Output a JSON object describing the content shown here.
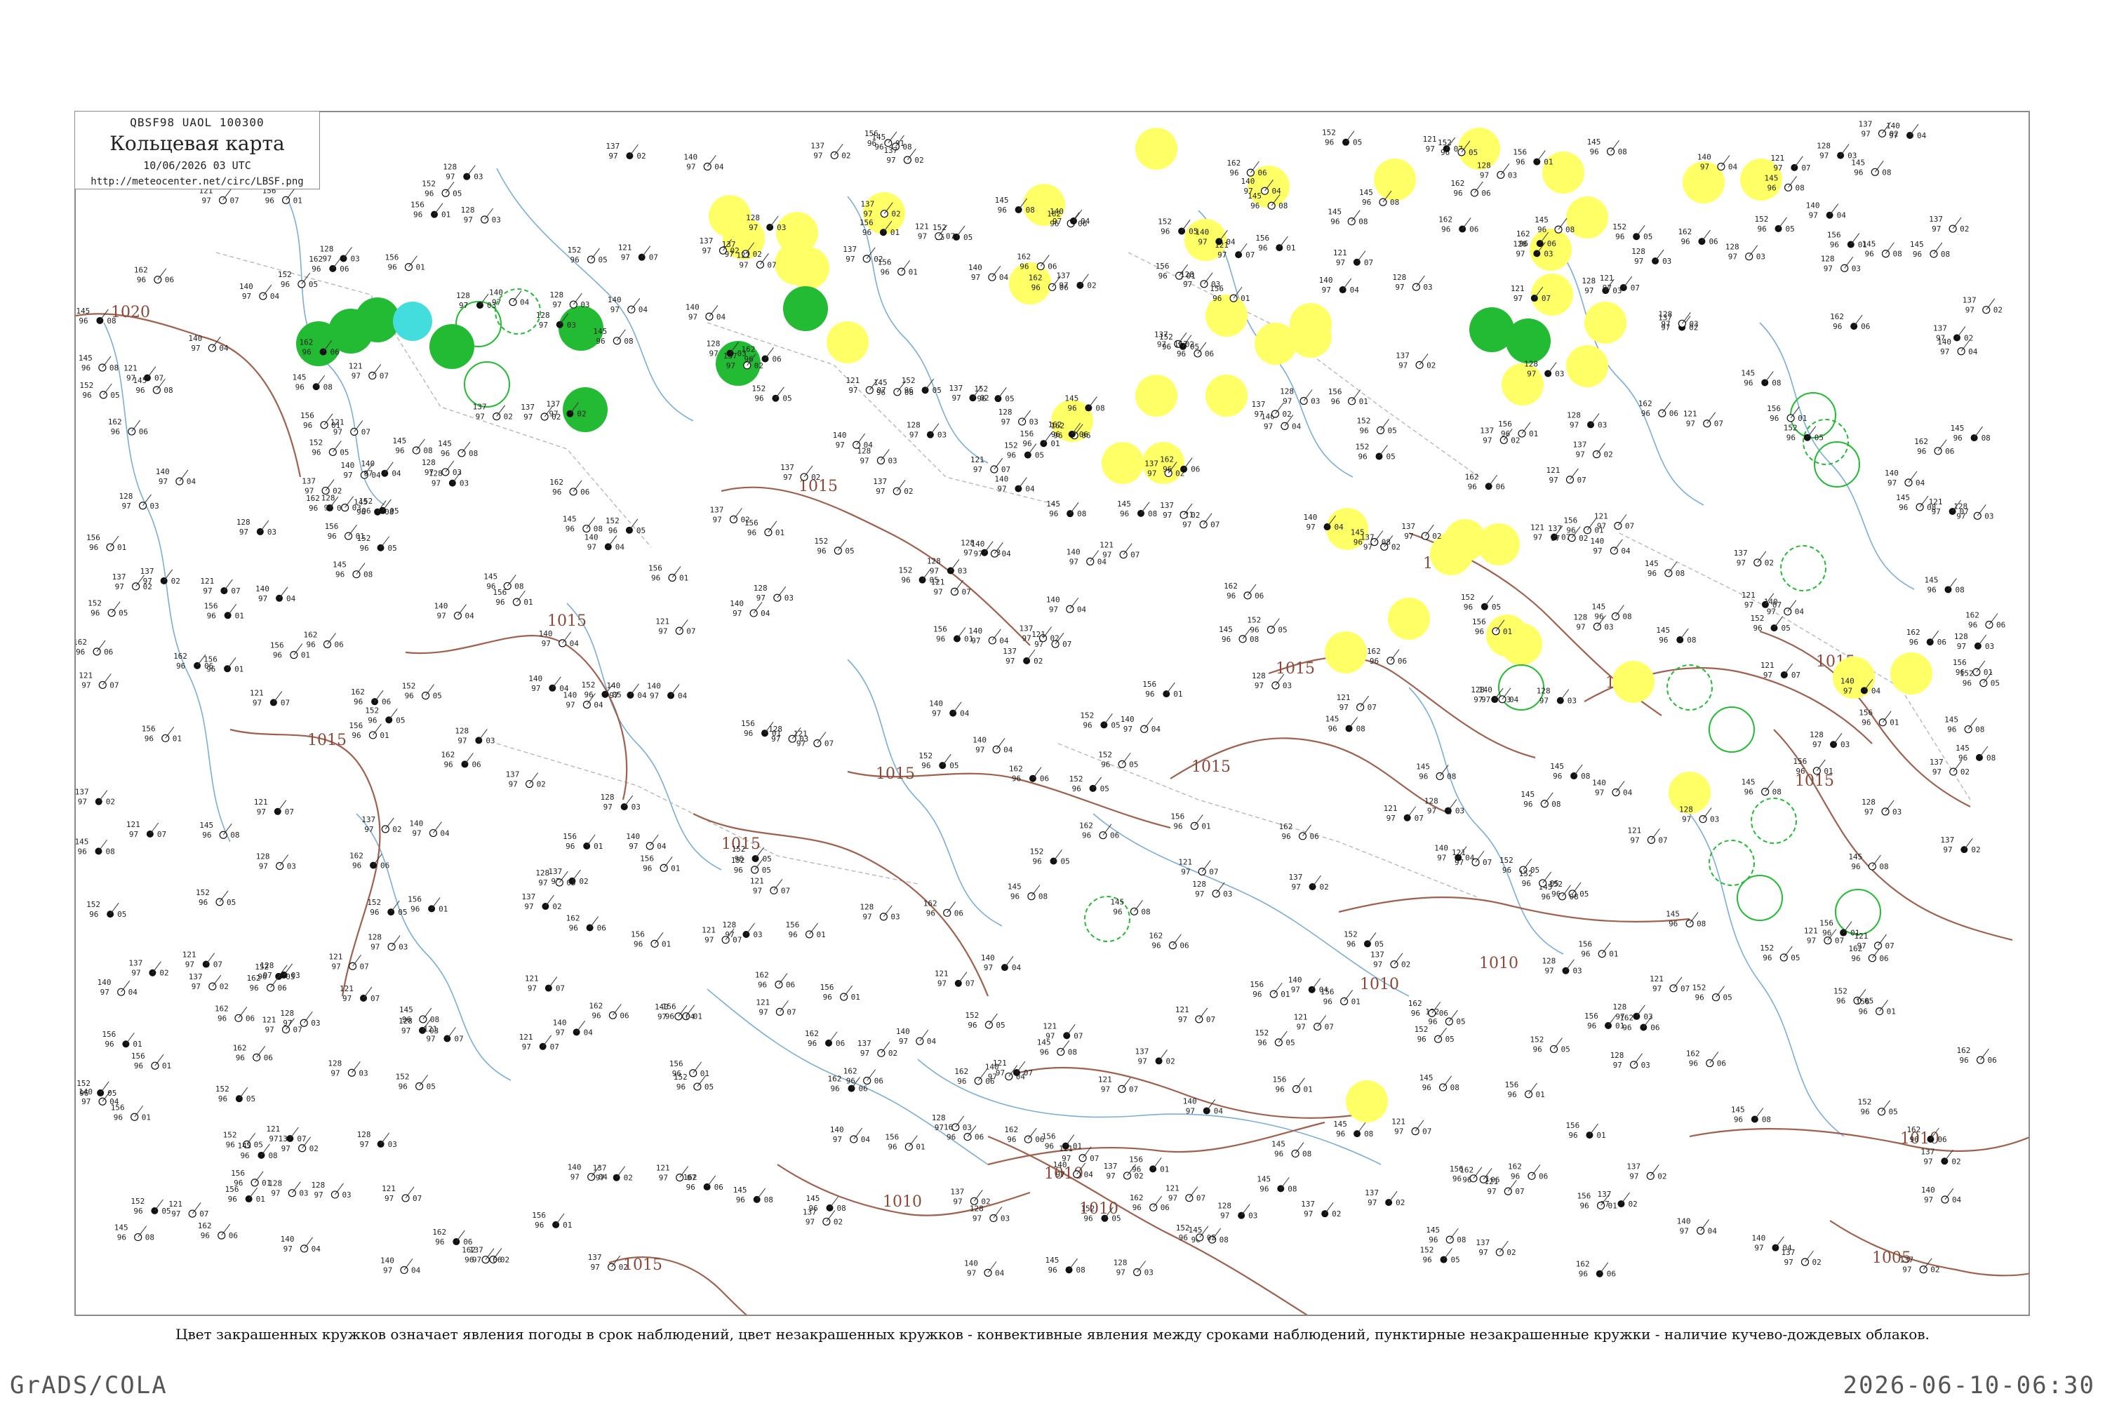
{
  "title_box": {
    "code_line": "QBSF98  UAOL  100300",
    "title": "Кольцевая карта",
    "date": "10/06/2026 03 UTC",
    "url": "http://meteocenter.net/circ/LBSF.png"
  },
  "caption": "Цвет закрашенных кружков означает явления погоды в срок наблюдений, цвет незакрашенных кружков - конвективные явления между сроками наблюдений, пунктирные незакрашенные кружки - наличие кучево-дождевых облаков.",
  "footer": {
    "left": "GrADS/COLA",
    "right": "2026-06-10-06:30"
  },
  "colors": {
    "isobar": "#a0604e",
    "coast": "#7aaed8",
    "border": "#b8b8b8",
    "yellow_phenomena": "#ffff66",
    "green_phenomena": "#22bb33",
    "cyan_phenomena": "#44dddd",
    "station_dot": "#111111"
  },
  "isobars": [
    {
      "label": "1020"
    },
    {
      "label": "1015"
    },
    {
      "label": "1015"
    },
    {
      "label": "1015"
    },
    {
      "label": "1015"
    },
    {
      "label": "1015"
    },
    {
      "label": "1015"
    },
    {
      "label": "1015"
    },
    {
      "label": "1015"
    },
    {
      "label": "1015"
    },
    {
      "label": "1015"
    },
    {
      "label": "1015"
    },
    {
      "label": "1010"
    },
    {
      "label": "1010"
    },
    {
      "label": "1010"
    },
    {
      "label": "1010"
    },
    {
      "label": "1010"
    },
    {
      "label": "1005"
    },
    {
      "label": "1015"
    },
    {
      "label": "1010"
    }
  ],
  "station_samples": [
    {
      "p": "162",
      "t": "96",
      "d": "06"
    },
    {
      "p": "140",
      "t": "97",
      "d": "04"
    },
    {
      "p": "152",
      "t": "96",
      "d": "05"
    },
    {
      "p": "128",
      "t": "97",
      "d": "03"
    },
    {
      "p": "145",
      "t": "96",
      "d": "08"
    },
    {
      "p": "137",
      "t": "97",
      "d": "02"
    },
    {
      "p": "156",
      "t": "96",
      "d": "01"
    },
    {
      "p": "121",
      "t": "97",
      "d": "07"
    }
  ]
}
